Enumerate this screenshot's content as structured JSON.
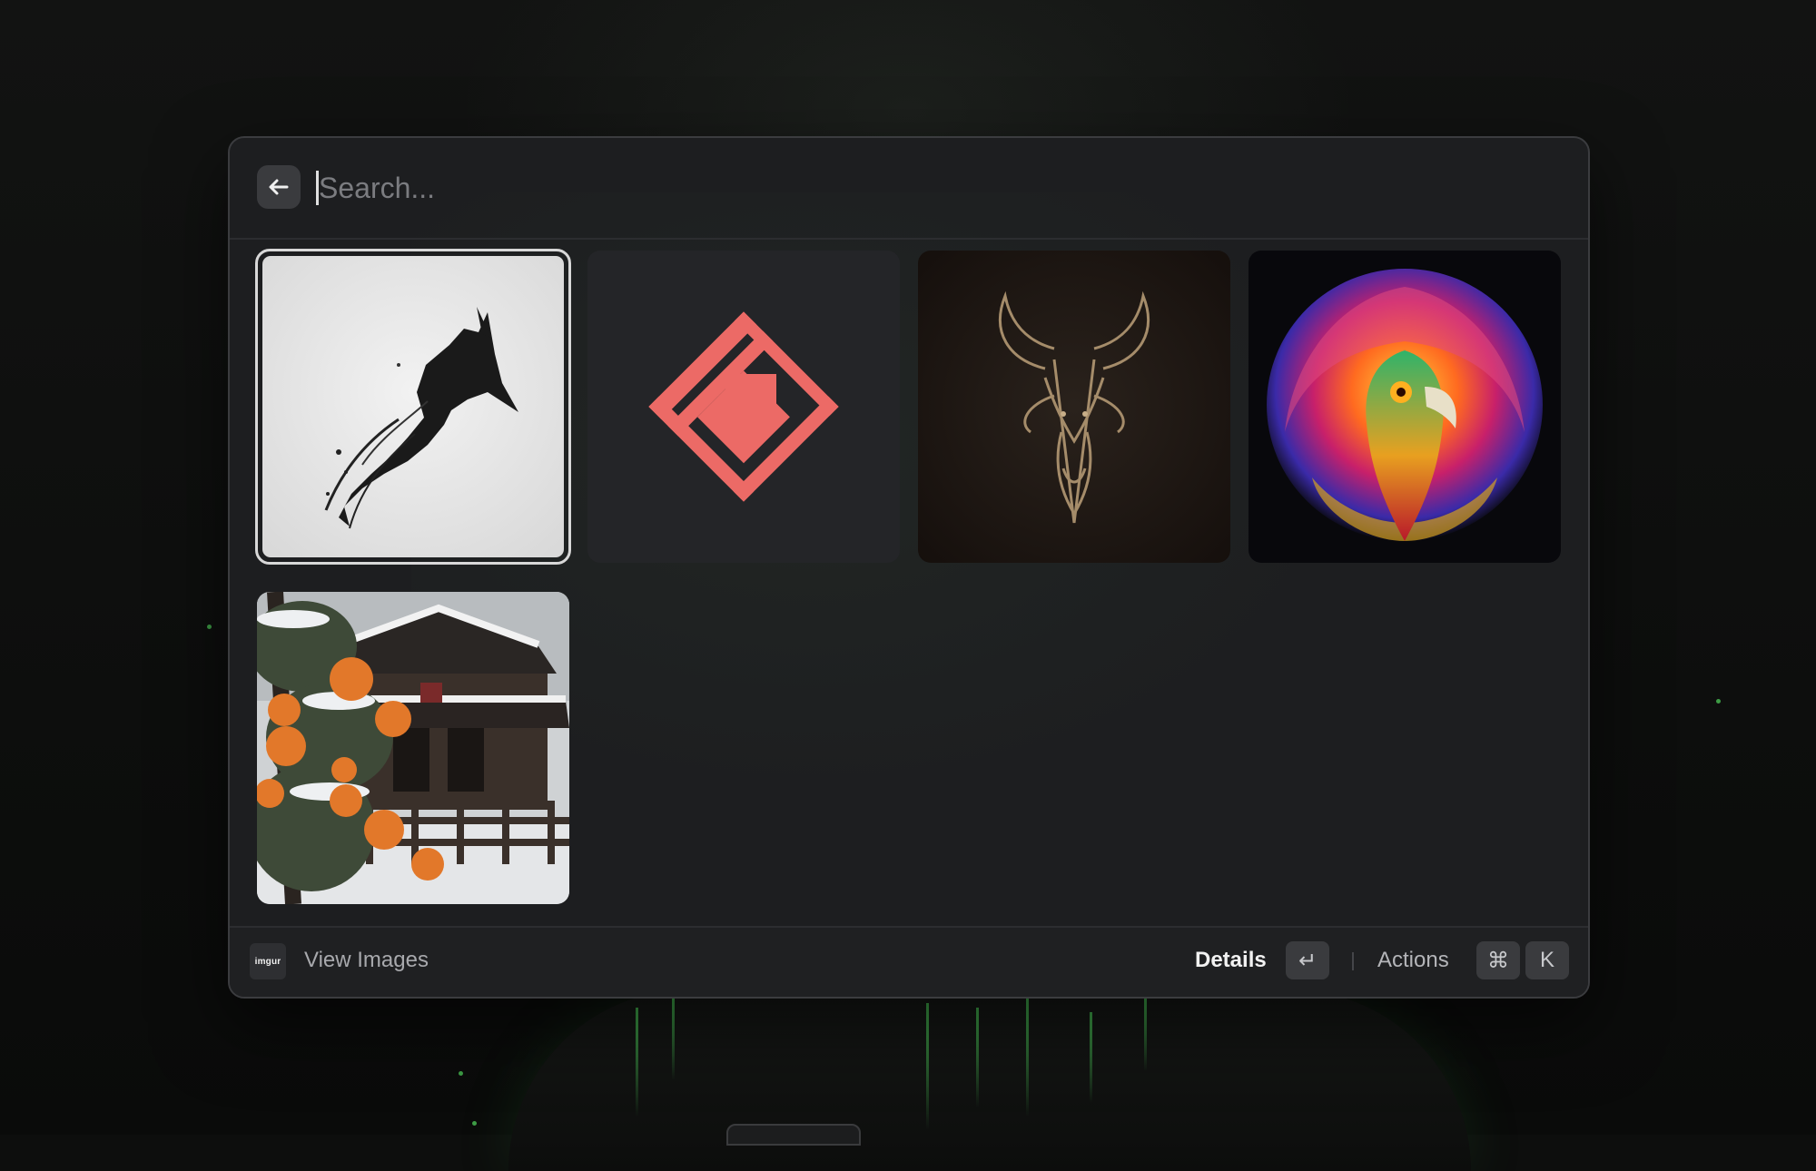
{
  "search": {
    "placeholder": "Search...",
    "value": ""
  },
  "grid": {
    "items": [
      {
        "subject": "ink fox head illustration",
        "selected": true
      },
      {
        "subject": "coral diamond logo",
        "selected": false
      },
      {
        "subject": "ornate stag head emblem",
        "selected": false
      },
      {
        "subject": "psychedelic phoenix",
        "selected": false
      },
      {
        "subject": "snowy orange tree by wooden house",
        "selected": false
      }
    ]
  },
  "footer": {
    "source_icon_text": "imgur",
    "title": "View Images",
    "primary_action": "Details",
    "primary_shortcut": "↵",
    "secondary_action": "Actions",
    "secondary_shortcut_modifier": "⌘",
    "secondary_shortcut_key": "K"
  },
  "colors": {
    "window_bg": "#1d1e20",
    "accent_coral": "#ec6a66",
    "key_bg": "#3a3b3e"
  }
}
